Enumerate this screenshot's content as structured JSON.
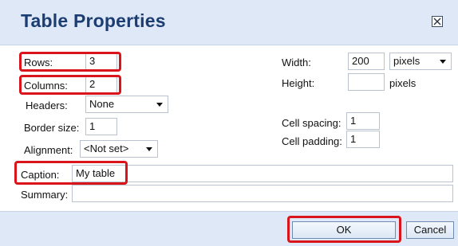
{
  "dialog": {
    "title": "Table Properties",
    "close_icon": "close-box-icon"
  },
  "fields": {
    "rows": {
      "label": "Rows:",
      "value": "3"
    },
    "columns": {
      "label": "Columns:",
      "value": "2"
    },
    "headers": {
      "label": "Headers:",
      "value": "None"
    },
    "border_size": {
      "label": "Border size:",
      "value": "1"
    },
    "alignment": {
      "label": "Alignment:",
      "value": "<Not set>"
    },
    "width": {
      "label": "Width:",
      "value": "200",
      "unit": "pixels"
    },
    "height": {
      "label": "Height:",
      "value": "",
      "unit": "pixels"
    },
    "cell_spacing": {
      "label": "Cell spacing:",
      "value": "1"
    },
    "cell_padding": {
      "label": "Cell padding:",
      "value": "1"
    },
    "caption": {
      "label": "Caption:",
      "value": "My table"
    },
    "summary": {
      "label": "Summary:",
      "value": ""
    }
  },
  "buttons": {
    "ok": "OK",
    "cancel": "Cancel"
  },
  "colors": {
    "highlight": "#d9151b",
    "title_text": "#1c3d72",
    "header_bg": "#dfe8f6"
  }
}
